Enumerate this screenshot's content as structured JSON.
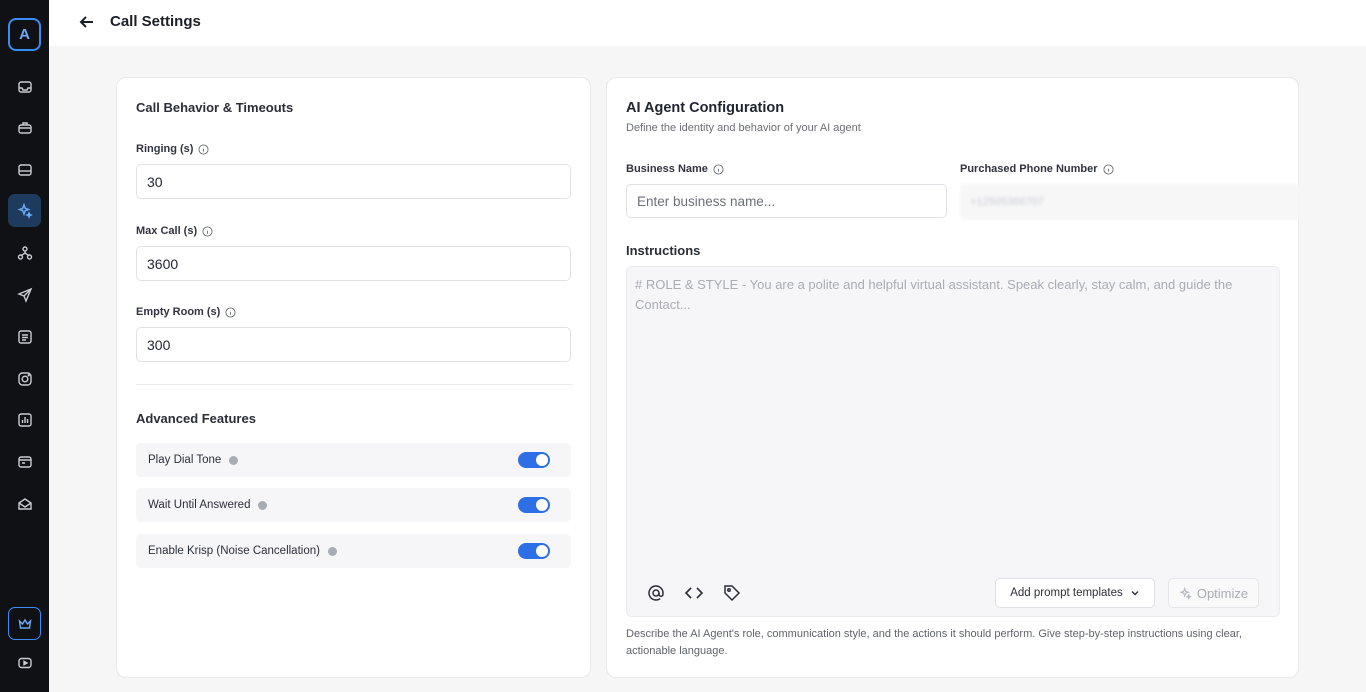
{
  "sidebar": {
    "logo_letter": "A",
    "icons": [
      "inbox-icon",
      "briefcase-icon",
      "database-icon",
      "sparkles-icon",
      "network-icon",
      "send-icon",
      "list-icon",
      "instagram-icon",
      "chart-icon",
      "window-icon",
      "mail-open-icon",
      "crown-icon",
      "video-icon"
    ],
    "active_index": 3,
    "accent_color": "#3b8df5"
  },
  "header": {
    "title": "Call Settings"
  },
  "left_card": {
    "title": "Call Behavior & Timeouts",
    "fields": [
      {
        "label": "Ringing (s)",
        "value": "30"
      },
      {
        "label": "Max Call (s)",
        "value": "3600"
      },
      {
        "label": "Empty Room (s)",
        "value": "300"
      }
    ],
    "advanced_title": "Advanced Features",
    "features": [
      {
        "label": "Play Dial Tone",
        "enabled": true
      },
      {
        "label": "Wait Until Answered",
        "enabled": true
      },
      {
        "label": "Enable Krisp (Noise Cancellation)",
        "enabled": true
      }
    ],
    "toggle_color": "#2f6fe6"
  },
  "right_card": {
    "title": "AI Agent Configuration",
    "subtitle": "Define the identity and behavior of your AI agent",
    "business_name": {
      "label": "Business Name",
      "placeholder": "Enter business name..."
    },
    "phone": {
      "label": "Purchased Phone Number",
      "value": "+12505366707"
    },
    "instructions": {
      "label": "Instructions",
      "placeholder": "# ROLE & STYLE - You are a polite and helpful virtual assistant. Speak clearly, stay calm, and guide the Contact...",
      "templates_button": "Add prompt templates",
      "optimize_button": "Optimize",
      "helper": "Describe the AI Agent's role, communication style, and the actions it should perform. Give step-by-step instructions using clear, actionable language."
    }
  }
}
